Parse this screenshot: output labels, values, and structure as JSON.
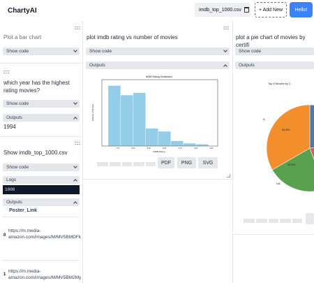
{
  "header": {
    "brand": "ChartyAI",
    "file_name": "imdb_top_1000.csv",
    "add_new_label": "+ Add New",
    "hello_label": "Hello!"
  },
  "col1": {
    "cell1": {
      "prompt": "Plot a bar chart",
      "show_code": "Show code"
    },
    "cell2": {
      "prompt": "which year has the highest rating movies?",
      "show_code": "Show code",
      "outputs": "Outputs",
      "result": "1994"
    },
    "cell3": {
      "prompt": "Show imdb_top_1000.csv",
      "show_code": "Show code",
      "logs": "Logs",
      "log_value": "1000",
      "outputs": "Outputs",
      "column_header": "Poster_Link",
      "rows": [
        {
          "idx": "0",
          "text": "https://m.media-amazon.com/images/M/MV5BMDFk..."
        },
        {
          "idx": "1",
          "text": "https://m.media-amazon.com/images/M/MV5BM2My..."
        }
      ]
    }
  },
  "col2": {
    "prompt": "plot imdb rating vs number of movies",
    "show_code": "Show code",
    "outputs": "Outputs",
    "export_buttons": [
      "PDF",
      "PNG",
      "SVG"
    ]
  },
  "col3": {
    "prompt": "plot a pie chart of movies by certifi",
    "show_code": "Show code",
    "outputs": "Outputs"
  },
  "chart_data": [
    {
      "type": "bar",
      "title": "IMDB Rating Distribution",
      "xlabel": "IMDB Rating",
      "ylabel": "Number of Movies",
      "x_ticks": [
        "7.75",
        "8.00",
        "8.25",
        "8.50",
        "8.75",
        "9.00",
        "9.25"
      ],
      "bins": [
        7.6,
        7.8,
        8.0,
        8.2,
        8.4,
        8.6,
        8.8,
        9.0,
        9.2
      ],
      "values": [
        255,
        215,
        225,
        75,
        62,
        22,
        12,
        8,
        2
      ],
      "ylim": [
        0,
        280
      ],
      "bar_color": "#93cde8"
    },
    {
      "type": "pie",
      "title": "Top 5 Movies by C",
      "labels": [
        "A",
        "UA",
        "",
        "",
        ""
      ],
      "percent_labels": [
        "34.8%",
        "22.5%"
      ],
      "colors": [
        "#4e79a7",
        "#e15759",
        "#59a14f",
        "#f28e2b",
        "#4e79a7"
      ]
    }
  ]
}
